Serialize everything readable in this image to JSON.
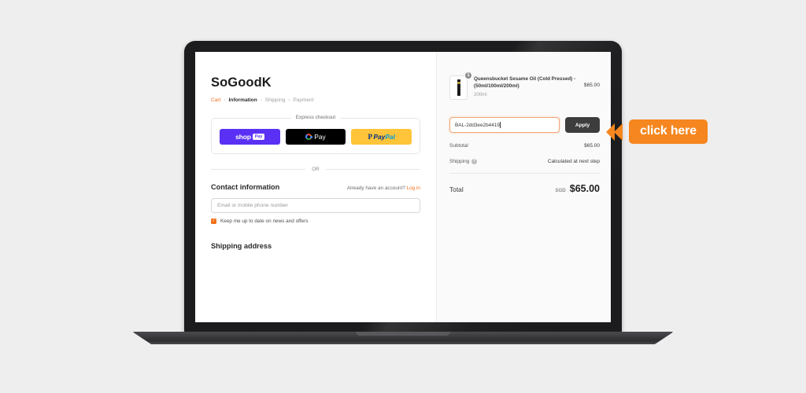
{
  "callout": {
    "label": "click here",
    "accent": "#f6861f",
    "arrow_count": 2
  },
  "checkout": {
    "brand": "SoGoodK",
    "breadcrumb": [
      {
        "label": "Cart",
        "state": "link"
      },
      {
        "label": "Information",
        "state": "current"
      },
      {
        "label": "Shipping",
        "state": "upcoming"
      },
      {
        "label": "Payment",
        "state": "upcoming"
      }
    ],
    "breadcrumb_separator": "›",
    "express": {
      "legend": "Express checkout",
      "buttons": [
        {
          "name": "shop-pay",
          "word": "shop",
          "chip": "Pay",
          "bg": "#5a31f4"
        },
        {
          "name": "google-pay",
          "word": "Pay",
          "bg": "#000000"
        },
        {
          "name": "paypal",
          "mark": "P",
          "word_a": "Pay",
          "word_b": "Pal",
          "bg": "#ffc439"
        }
      ]
    },
    "divider_label": "OR",
    "contact": {
      "title": "Contact information",
      "account_prompt": "Already have an account?",
      "login_link": "Log in",
      "email_placeholder": "Email or mobile phone number",
      "email_value": "",
      "newsletter_label": "Keep me up to date on news and offers",
      "newsletter_checked": true,
      "newsletter_check_glyph": "✓"
    },
    "shipping_section_title": "Shipping address"
  },
  "summary": {
    "item": {
      "quantity": "1",
      "name": "Queensbucket Sesame Oil (Cold Pressed) - (50ml/100ml/200ml)",
      "variant": "200ml",
      "price": "$65.00"
    },
    "discount": {
      "value": "BAL-2dd3ee2b4419",
      "placeholder": "Discount code or gift card",
      "apply_label": "Apply"
    },
    "lines": [
      {
        "label": "Subtotal",
        "value": "$65.00",
        "has_info_icon": false
      },
      {
        "label": "Shipping",
        "value": "Calculated at next step",
        "has_info_icon": true
      }
    ],
    "info_glyph": "?",
    "total": {
      "label": "Total",
      "currency": "SGD",
      "amount": "$65.00"
    }
  }
}
